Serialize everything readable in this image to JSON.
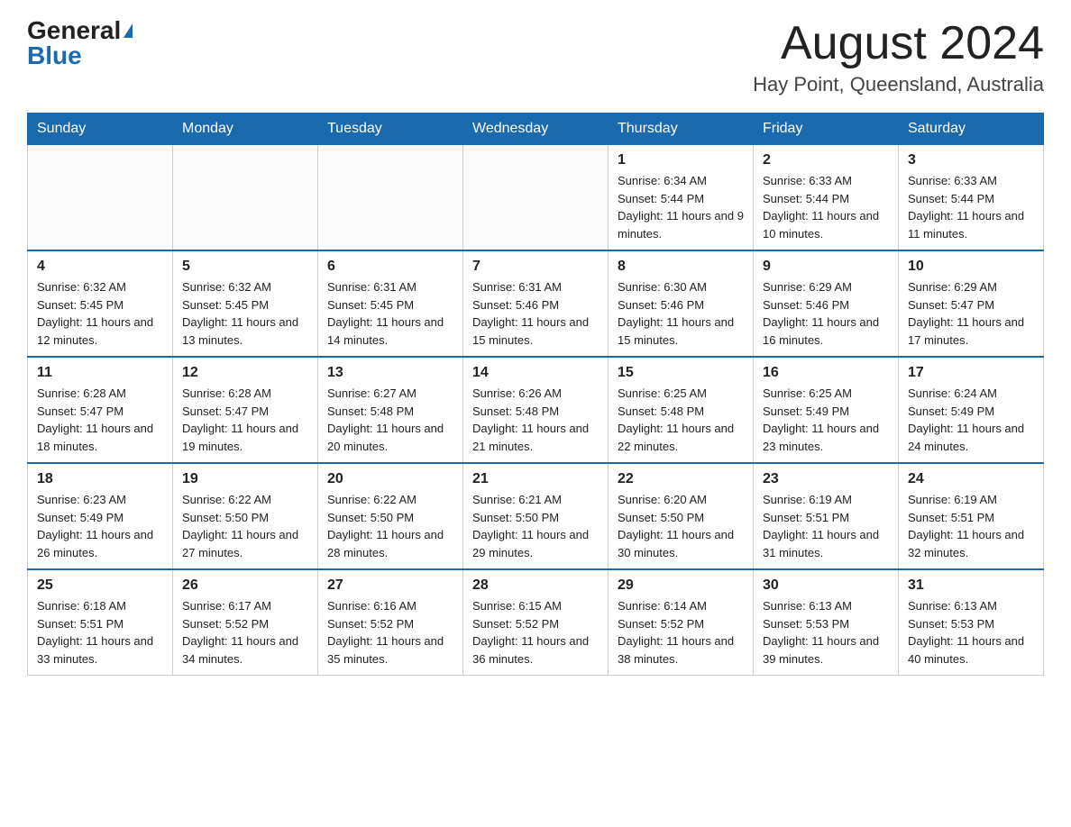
{
  "header": {
    "logo_general": "General",
    "logo_blue": "Blue",
    "month_title": "August 2024",
    "location": "Hay Point, Queensland, Australia"
  },
  "weekdays": [
    "Sunday",
    "Monday",
    "Tuesday",
    "Wednesday",
    "Thursday",
    "Friday",
    "Saturday"
  ],
  "weeks": [
    [
      {
        "day": "",
        "info": ""
      },
      {
        "day": "",
        "info": ""
      },
      {
        "day": "",
        "info": ""
      },
      {
        "day": "",
        "info": ""
      },
      {
        "day": "1",
        "info": "Sunrise: 6:34 AM\nSunset: 5:44 PM\nDaylight: 11 hours and 9 minutes."
      },
      {
        "day": "2",
        "info": "Sunrise: 6:33 AM\nSunset: 5:44 PM\nDaylight: 11 hours and 10 minutes."
      },
      {
        "day": "3",
        "info": "Sunrise: 6:33 AM\nSunset: 5:44 PM\nDaylight: 11 hours and 11 minutes."
      }
    ],
    [
      {
        "day": "4",
        "info": "Sunrise: 6:32 AM\nSunset: 5:45 PM\nDaylight: 11 hours and 12 minutes."
      },
      {
        "day": "5",
        "info": "Sunrise: 6:32 AM\nSunset: 5:45 PM\nDaylight: 11 hours and 13 minutes."
      },
      {
        "day": "6",
        "info": "Sunrise: 6:31 AM\nSunset: 5:45 PM\nDaylight: 11 hours and 14 minutes."
      },
      {
        "day": "7",
        "info": "Sunrise: 6:31 AM\nSunset: 5:46 PM\nDaylight: 11 hours and 15 minutes."
      },
      {
        "day": "8",
        "info": "Sunrise: 6:30 AM\nSunset: 5:46 PM\nDaylight: 11 hours and 15 minutes."
      },
      {
        "day": "9",
        "info": "Sunrise: 6:29 AM\nSunset: 5:46 PM\nDaylight: 11 hours and 16 minutes."
      },
      {
        "day": "10",
        "info": "Sunrise: 6:29 AM\nSunset: 5:47 PM\nDaylight: 11 hours and 17 minutes."
      }
    ],
    [
      {
        "day": "11",
        "info": "Sunrise: 6:28 AM\nSunset: 5:47 PM\nDaylight: 11 hours and 18 minutes."
      },
      {
        "day": "12",
        "info": "Sunrise: 6:28 AM\nSunset: 5:47 PM\nDaylight: 11 hours and 19 minutes."
      },
      {
        "day": "13",
        "info": "Sunrise: 6:27 AM\nSunset: 5:48 PM\nDaylight: 11 hours and 20 minutes."
      },
      {
        "day": "14",
        "info": "Sunrise: 6:26 AM\nSunset: 5:48 PM\nDaylight: 11 hours and 21 minutes."
      },
      {
        "day": "15",
        "info": "Sunrise: 6:25 AM\nSunset: 5:48 PM\nDaylight: 11 hours and 22 minutes."
      },
      {
        "day": "16",
        "info": "Sunrise: 6:25 AM\nSunset: 5:49 PM\nDaylight: 11 hours and 23 minutes."
      },
      {
        "day": "17",
        "info": "Sunrise: 6:24 AM\nSunset: 5:49 PM\nDaylight: 11 hours and 24 minutes."
      }
    ],
    [
      {
        "day": "18",
        "info": "Sunrise: 6:23 AM\nSunset: 5:49 PM\nDaylight: 11 hours and 26 minutes."
      },
      {
        "day": "19",
        "info": "Sunrise: 6:22 AM\nSunset: 5:50 PM\nDaylight: 11 hours and 27 minutes."
      },
      {
        "day": "20",
        "info": "Sunrise: 6:22 AM\nSunset: 5:50 PM\nDaylight: 11 hours and 28 minutes."
      },
      {
        "day": "21",
        "info": "Sunrise: 6:21 AM\nSunset: 5:50 PM\nDaylight: 11 hours and 29 minutes."
      },
      {
        "day": "22",
        "info": "Sunrise: 6:20 AM\nSunset: 5:50 PM\nDaylight: 11 hours and 30 minutes."
      },
      {
        "day": "23",
        "info": "Sunrise: 6:19 AM\nSunset: 5:51 PM\nDaylight: 11 hours and 31 minutes."
      },
      {
        "day": "24",
        "info": "Sunrise: 6:19 AM\nSunset: 5:51 PM\nDaylight: 11 hours and 32 minutes."
      }
    ],
    [
      {
        "day": "25",
        "info": "Sunrise: 6:18 AM\nSunset: 5:51 PM\nDaylight: 11 hours and 33 minutes."
      },
      {
        "day": "26",
        "info": "Sunrise: 6:17 AM\nSunset: 5:52 PM\nDaylight: 11 hours and 34 minutes."
      },
      {
        "day": "27",
        "info": "Sunrise: 6:16 AM\nSunset: 5:52 PM\nDaylight: 11 hours and 35 minutes."
      },
      {
        "day": "28",
        "info": "Sunrise: 6:15 AM\nSunset: 5:52 PM\nDaylight: 11 hours and 36 minutes."
      },
      {
        "day": "29",
        "info": "Sunrise: 6:14 AM\nSunset: 5:52 PM\nDaylight: 11 hours and 38 minutes."
      },
      {
        "day": "30",
        "info": "Sunrise: 6:13 AM\nSunset: 5:53 PM\nDaylight: 11 hours and 39 minutes."
      },
      {
        "day": "31",
        "info": "Sunrise: 6:13 AM\nSunset: 5:53 PM\nDaylight: 11 hours and 40 minutes."
      }
    ]
  ]
}
